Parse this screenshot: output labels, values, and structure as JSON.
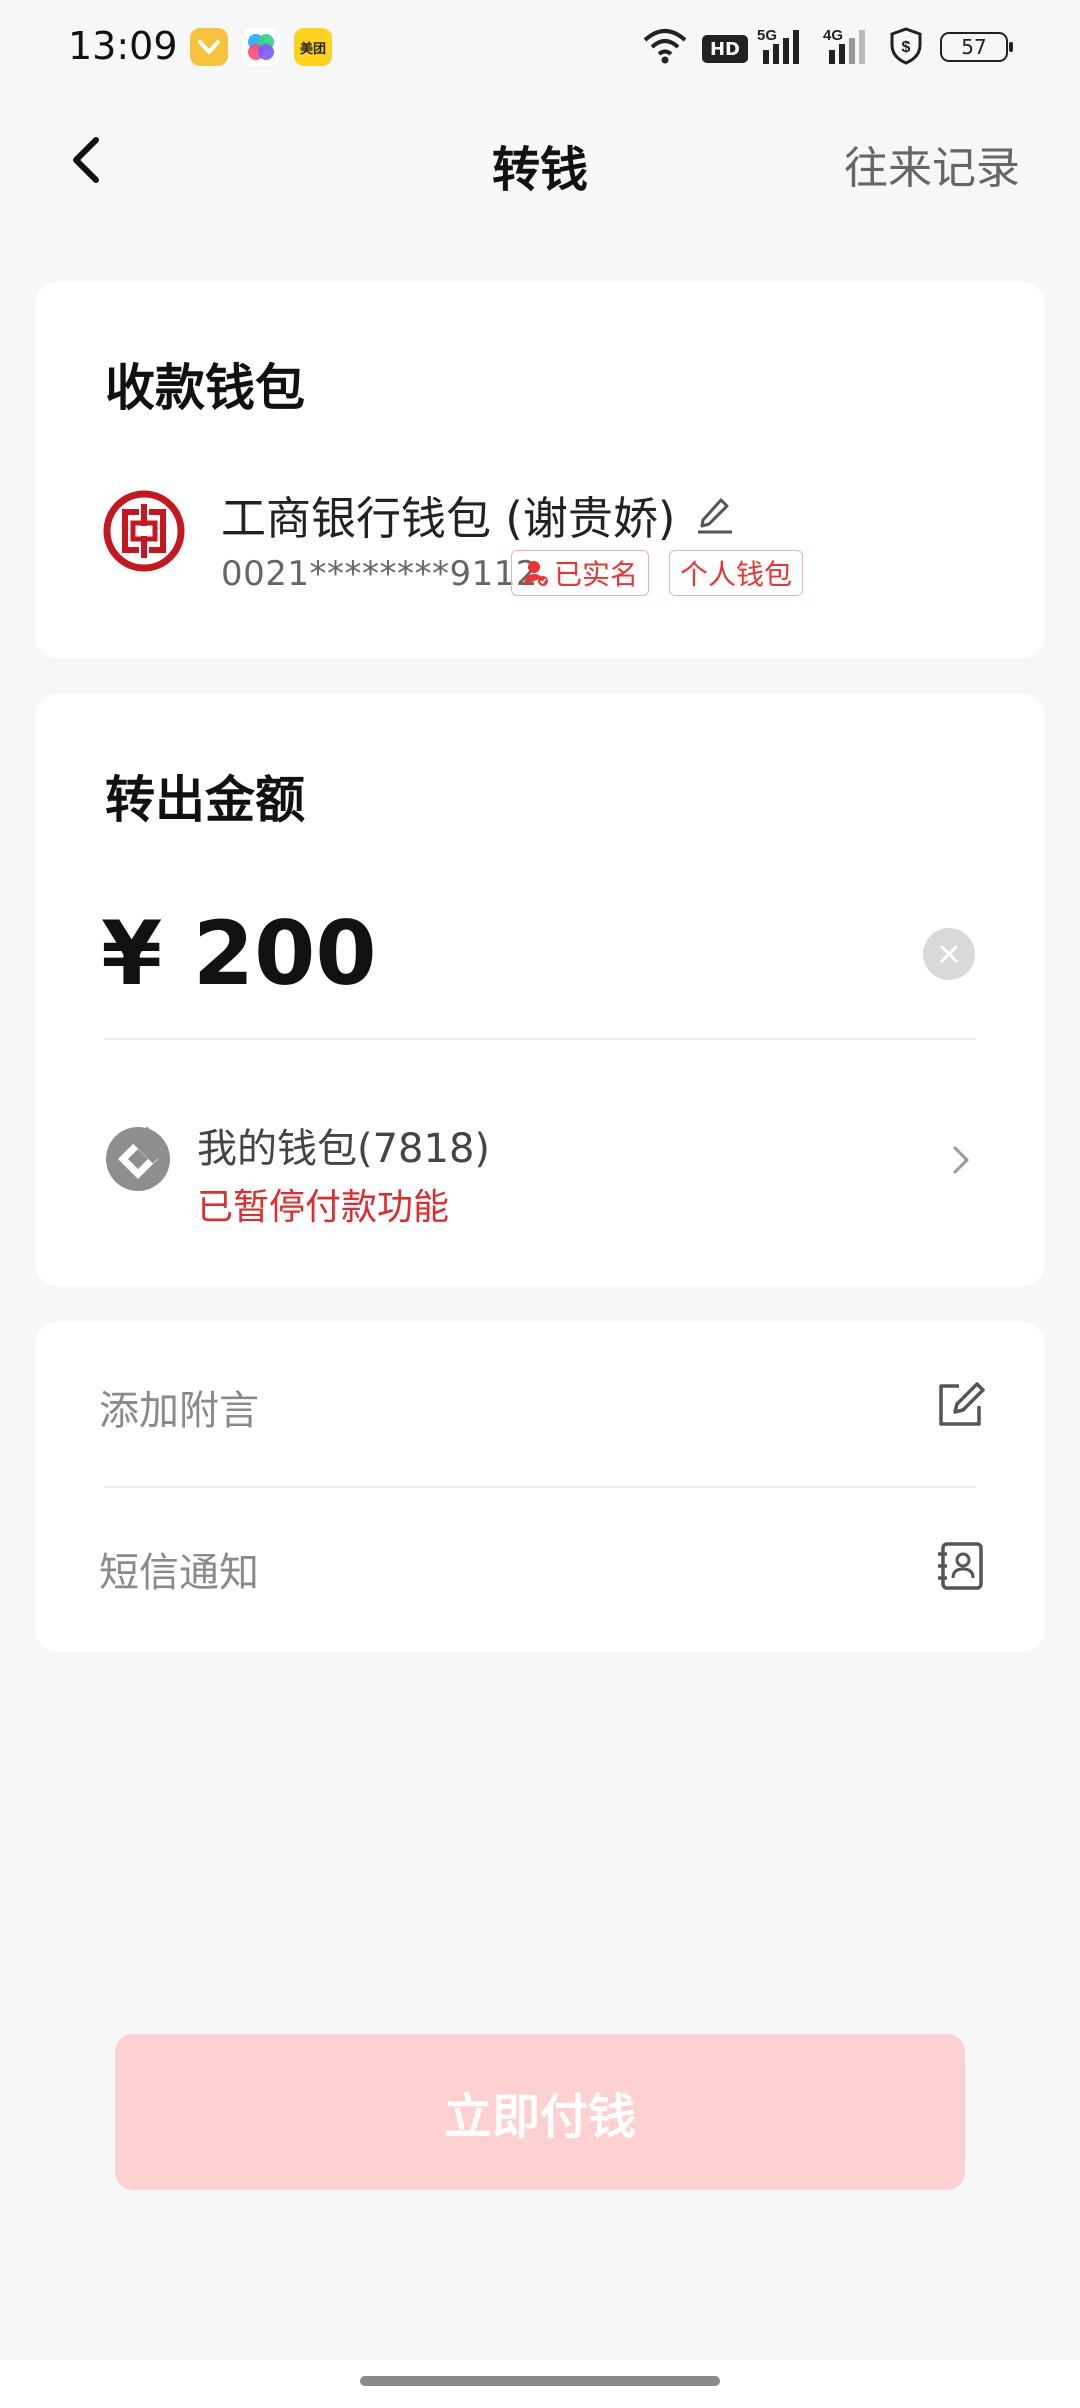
{
  "status_bar": {
    "time": "13:09",
    "app_3_label": "美团",
    "battery": "57",
    "network_1": "5G",
    "network_2": "4G",
    "hd": "HD"
  },
  "header": {
    "title": "转钱",
    "records": "往来记录"
  },
  "payee": {
    "section_title": "收款钱包",
    "wallet_name": "工商银行钱包 (谢贵娇)",
    "account": "0021********9112",
    "tag_verified": "已实名",
    "tag_personal": "个人钱包",
    "logo_icon": "icbc-logo-icon"
  },
  "amount": {
    "section_title": "转出金额",
    "value": "¥ 200",
    "source_wallet": "我的钱包(7818)",
    "source_status": "已暂停付款功能"
  },
  "options": {
    "note_label": "添加附言",
    "sms_label": "短信通知"
  },
  "pay_button": "立即付钱",
  "colors": {
    "accent_red": "#e02c2c",
    "button_disabled": "#ffd0d0",
    "background": "#f6f7f9"
  }
}
